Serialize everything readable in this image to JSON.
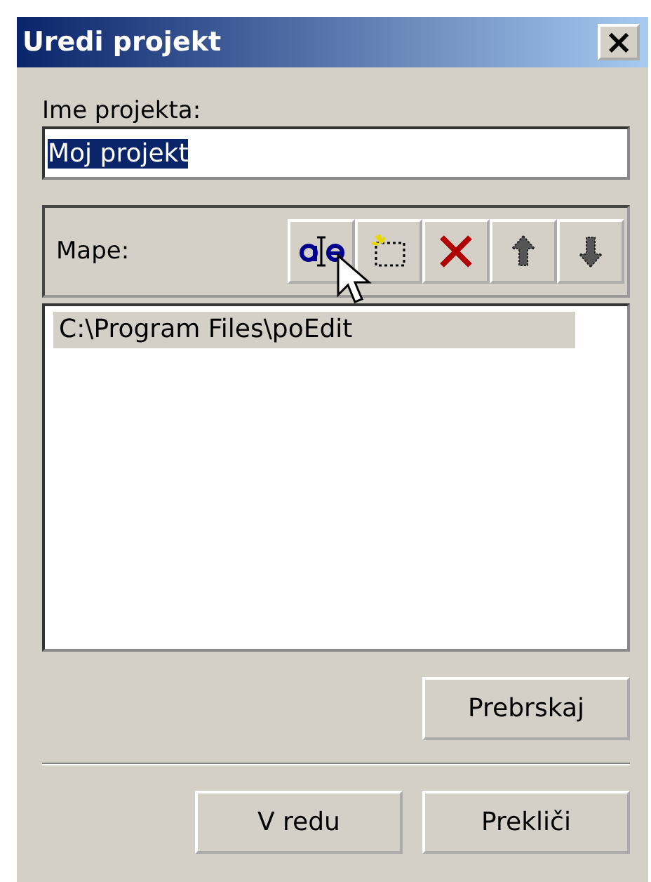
{
  "window": {
    "title": "Uredi projekt",
    "close": "×"
  },
  "name_label": "Ime projekta:",
  "name_field": {
    "value": "Moj projekt",
    "value_selected": true
  },
  "folders": {
    "label": "Mape:",
    "tools": [
      {
        "kind": "rename"
      },
      {
        "kind": "new"
      },
      {
        "kind": "delete"
      },
      {
        "kind": "up"
      },
      {
        "kind": "down"
      }
    ],
    "items": [
      {
        "text": "C:\\Program Files\\poEdit",
        "selected": true
      }
    ]
  },
  "browse_button": "Prebrskaj",
  "buttons": [
    "V redu",
    "Prekliči"
  ]
}
